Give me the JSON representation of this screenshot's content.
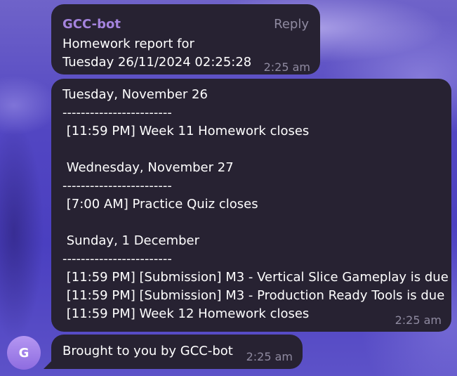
{
  "messages": [
    {
      "sender": "GCC-bot",
      "reply_label": "Reply",
      "text": "Homework report for\nTuesday 26/11/2024 02:25:28",
      "time": "2:25 am"
    },
    {
      "text": "Tuesday, November 26\n------------------------\n [11:59 PM] Week 11 Homework closes\n\n Wednesday, November 27\n------------------------\n [7:00 AM] Practice Quiz closes\n\n Sunday, 1 December\n------------------------\n [11:59 PM] [Submission] M3 - Vertical Slice Gameplay is due\n [11:59 PM] [Submission] M3 - Production Ready Tools is due\n [11:59 PM] Week 12 Homework closes",
      "time": "2:25 am"
    },
    {
      "text": "Brought to you by GCC-bot",
      "time": "2:25 am"
    }
  ],
  "avatar": {
    "initial": "G",
    "color": "#a483dd"
  },
  "colors": {
    "bubble": "#272232",
    "sender": "#a483dd",
    "time": "#8f8aa0",
    "background": "#5246c2"
  }
}
